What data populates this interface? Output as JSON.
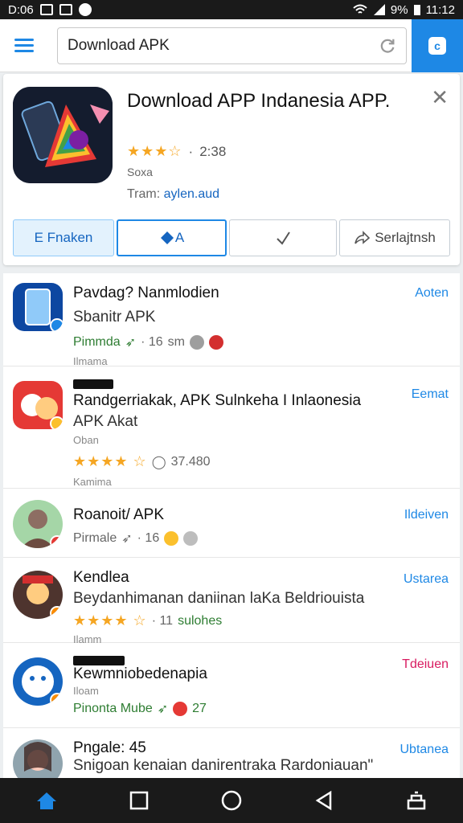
{
  "status_bar": {
    "time_left": "D:06",
    "battery": "9%",
    "time_right": "11:12"
  },
  "search": {
    "value": "Download APK"
  },
  "featured": {
    "title": "Download APP Indanesia APP.",
    "rating": "2:38",
    "meta": "Soxa",
    "dev_prefix": "Tram:",
    "dev_name": "aylen.aud",
    "actions": {
      "primary": "E Fnaken",
      "second": "A",
      "share": "Serlajtnsh"
    }
  },
  "apps": [
    {
      "name": "Pavdag? Nanmlodien",
      "sub": "Sbanitr APK",
      "stats_prefix": "Pimmda",
      "stats": "· 16",
      "stats_extra": "sm",
      "small": "Ilmama",
      "action": "Aoten"
    },
    {
      "name": "Randgerriakak, APK Sulnkeha I Inlaonesia",
      "sub": "APK Akat",
      "small_top": "Oban",
      "stats": "37.480",
      "small": "Kamima",
      "action": "Eemat"
    },
    {
      "name": "Roanoit/ APK",
      "stats_prefix": "Pirmale",
      "stats": "· 16",
      "action": "Ildeiven"
    },
    {
      "name": "Kendlea",
      "sub": "Beydanhimanan daniinan laKa Beldriouista",
      "stats": "· 11",
      "stats_extra": "sulohes",
      "small": "Ilamm",
      "action": "Ustarea"
    },
    {
      "name": "Kewmniobedenapia",
      "small_top": "Iloam",
      "stats_prefix": "Pinonta  Mube",
      "stats": "27",
      "action": "Tdeiuen"
    },
    {
      "name": "Pngale: 45",
      "sub": "Snigoan kenaian danirentraka Rardoniauan\"",
      "action": "Ubtanea"
    }
  ],
  "colors": {
    "accent": "#1e88e5",
    "star": "#f5a623",
    "green": "#2e7d32"
  }
}
